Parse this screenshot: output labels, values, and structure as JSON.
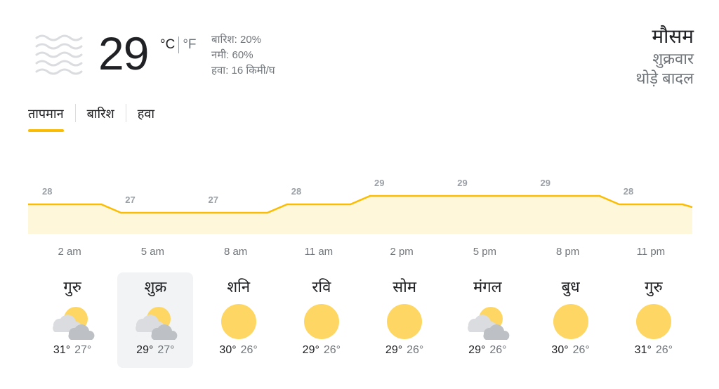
{
  "current": {
    "temperature": "29",
    "unit_c": "°C",
    "unit_f": "°F",
    "rain": "बारिश: 20%",
    "humidity": "नमी: 60%",
    "wind": "हवा: 16 किमी/घ",
    "icon": "haze-icon"
  },
  "header_right": {
    "title": "मौसम",
    "day": "शुक्रवार",
    "condition": "थोड़े बादल"
  },
  "tabs": [
    {
      "label": "तापमान",
      "active": true
    },
    {
      "label": "बारिश",
      "active": false
    },
    {
      "label": "हवा",
      "active": false
    }
  ],
  "colors": {
    "accent": "#fbbc04",
    "chart_fill": "#fef7d9",
    "sun": "#fdd663"
  },
  "chart_data": {
    "type": "area",
    "labels": [
      "28",
      "27",
      "27",
      "28",
      "29",
      "29",
      "29",
      "28"
    ],
    "x": [
      "2 am",
      "5 am",
      "8 am",
      "11 am",
      "2 pm",
      "5 pm",
      "8 pm",
      "11 pm"
    ],
    "values": [
      28,
      27,
      27,
      28,
      29,
      29,
      29,
      28
    ]
  },
  "hours": [
    "2 am",
    "5 am",
    "8 am",
    "11 am",
    "2 pm",
    "5 pm",
    "8 pm",
    "11 pm"
  ],
  "days": [
    {
      "name": "गुरु",
      "icon": "partly-cloudy-icon",
      "high": "31°",
      "low": "27°",
      "selected": false
    },
    {
      "name": "शुक्र",
      "icon": "partly-cloudy-icon",
      "high": "29°",
      "low": "27°",
      "selected": true
    },
    {
      "name": "शनि",
      "icon": "sunny-icon",
      "high": "30°",
      "low": "26°",
      "selected": false
    },
    {
      "name": "रवि",
      "icon": "sunny-icon",
      "high": "29°",
      "low": "26°",
      "selected": false
    },
    {
      "name": "सोम",
      "icon": "sunny-icon",
      "high": "29°",
      "low": "26°",
      "selected": false
    },
    {
      "name": "मंगल",
      "icon": "partly-cloudy-icon",
      "high": "29°",
      "low": "26°",
      "selected": false
    },
    {
      "name": "बुध",
      "icon": "sunny-icon",
      "high": "30°",
      "low": "26°",
      "selected": false
    },
    {
      "name": "गुरु",
      "icon": "sunny-icon",
      "high": "31°",
      "low": "26°",
      "selected": false
    }
  ]
}
